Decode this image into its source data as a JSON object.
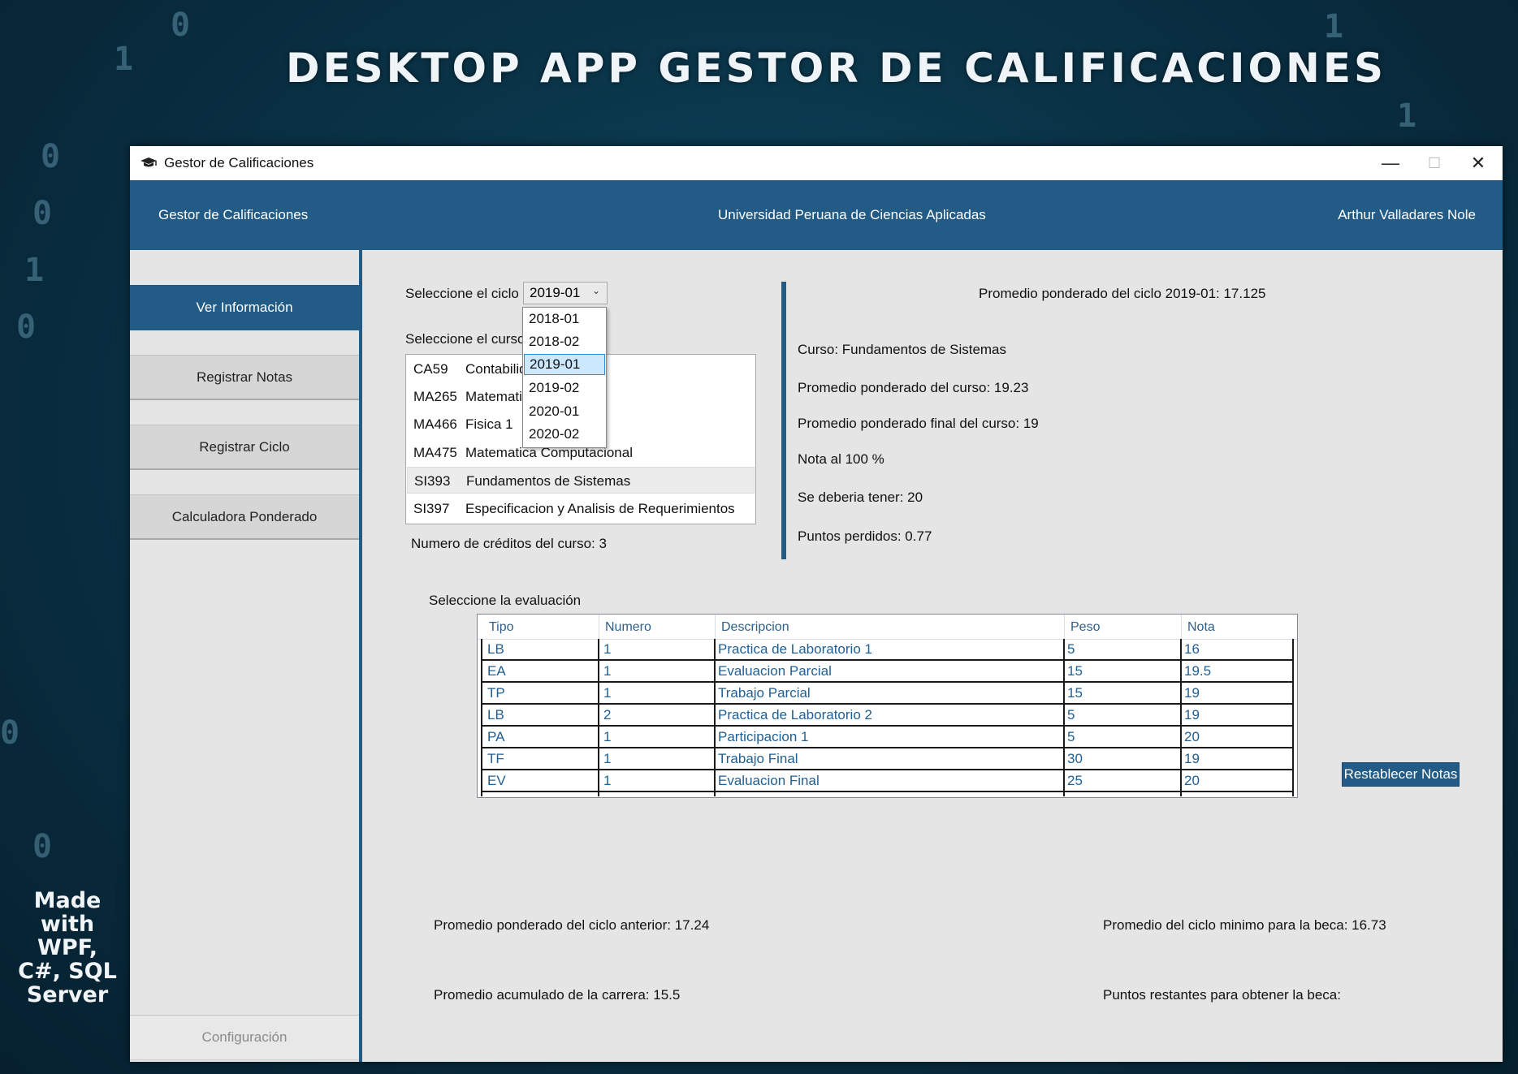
{
  "banner": {
    "title": "DESKTOP APP GESTOR DE CALIFICACIONES",
    "made_with": [
      "Made",
      "with",
      "WPF,",
      "C#, SQL",
      "Server"
    ]
  },
  "window": {
    "title": "Gestor de Calificaciones",
    "controls": {
      "minimize": "—",
      "maximize": "☐",
      "close": "✕"
    }
  },
  "header": {
    "app_name": "Gestor de Calificaciones",
    "university": "Universidad Peruana de Ciencias Aplicadas",
    "user": "Arthur Valladares Nole"
  },
  "sidebar": {
    "items": [
      {
        "label": "Ver Información"
      },
      {
        "label": "Registrar Notas"
      },
      {
        "label": "Registrar Ciclo"
      },
      {
        "label": "Calculadora Ponderado"
      }
    ],
    "config_label": "Configuración"
  },
  "cycle": {
    "label": "Seleccione el ciclo",
    "selected": "2019-01",
    "options": [
      "2018-01",
      "2018-02",
      "2019-01",
      "2019-02",
      "2020-01",
      "2020-02"
    ]
  },
  "course": {
    "label": "Seleccione el curso",
    "items": [
      {
        "code": "CA59",
        "name": "Contabilidad"
      },
      {
        "code": "MA265",
        "name": "Matematica"
      },
      {
        "code": "MA466",
        "name": "Fisica 1"
      },
      {
        "code": "MA475",
        "name": "Matematica Computacional"
      },
      {
        "code": "SI393",
        "name": "Fundamentos de Sistemas"
      },
      {
        "code": "SI397",
        "name": "Especificacion y Analisis de Requerimientos"
      }
    ],
    "credits": "Numero de créditos del curso: 3"
  },
  "summary": {
    "cycle_avg": "Promedio ponderado del ciclo 2019-01: 17.125",
    "course": "Curso: Fundamentos de Sistemas",
    "course_avg": "Promedio ponderado del curso: 19.23",
    "course_final_avg": "Promedio ponderado final del curso: 19",
    "grade_100": "Nota al 100 %",
    "should_have": "Se deberia tener: 20",
    "lost_points": "Puntos perdidos: 0.77"
  },
  "evaluation": {
    "label": "Seleccione la evaluación",
    "columns": [
      "Tipo",
      "Numero",
      "Descripcion",
      "Peso",
      "Nota"
    ],
    "rows": [
      [
        "LB",
        "1",
        "Practica de Laboratorio 1",
        "5",
        "16"
      ],
      [
        "EA",
        "1",
        "Evaluacion Parcial",
        "15",
        "19.5"
      ],
      [
        "TP",
        "1",
        "Trabajo Parcial",
        "15",
        "19"
      ],
      [
        "LB",
        "2",
        "Practica de Laboratorio 2",
        "5",
        "19"
      ],
      [
        "PA",
        "1",
        "Participacion 1",
        "5",
        "20"
      ],
      [
        "TF",
        "1",
        "Trabajo Final",
        "30",
        "19"
      ],
      [
        "EV",
        "1",
        "Evaluacion Final",
        "25",
        "20"
      ]
    ],
    "restore_label": "Restablecer Notas"
  },
  "footer": {
    "prev_cycle_avg": "Promedio ponderado del ciclo anterior: 17.24",
    "career_avg": "Promedio acumulado de la carrera: 15.5",
    "min_scholarship": "Promedio del ciclo minimo para la beca: 16.73",
    "remaining_points": "Puntos restantes para obtener la beca:"
  }
}
